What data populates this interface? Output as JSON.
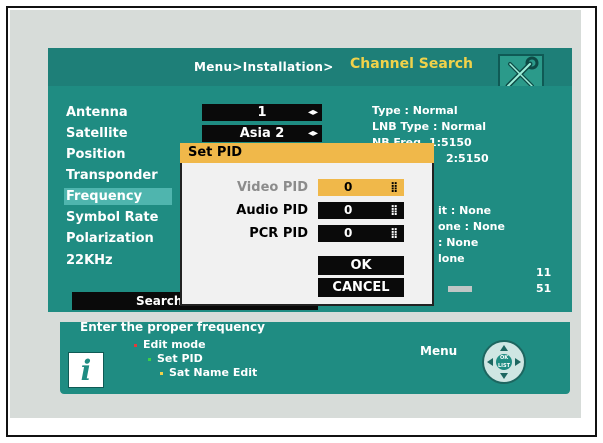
{
  "header": {
    "breadcrumb": "Menu>Installation>",
    "title": "Channel Search"
  },
  "settings": [
    {
      "label": "Antenna",
      "value": "1",
      "arrows": "◂▸"
    },
    {
      "label": "Satellite",
      "value": "Asia 2",
      "arrows": "◂▸"
    },
    {
      "label": "Position",
      "value": ""
    },
    {
      "label": "Transponder",
      "value": ""
    },
    {
      "label": "Frequency",
      "value": ""
    },
    {
      "label": "Symbol Rate",
      "value": ""
    },
    {
      "label": "Polarization",
      "value": ""
    },
    {
      "label": "22KHz",
      "value": ""
    }
  ],
  "info": {
    "type": "Type : Normal",
    "lnb_type": "LNB Type : Normal",
    "lnb_freq1": "NB Freq. 1:5150",
    "lnb_freq2": "2:5150",
    "partial1": "it : None",
    "partial2": "one : None",
    "partial3": ": None",
    "partial4": "lone",
    "level1": "11",
    "level2": "51"
  },
  "search_button": "Search",
  "dialog": {
    "title": "Set PID",
    "video_label": "Video PID",
    "video_value": "0",
    "audio_label": "Audio PID",
    "audio_value": "0",
    "pcr_label": "PCR  PID",
    "pcr_value": "0",
    "ok": "OK",
    "cancel": "CANCEL"
  },
  "help": {
    "text": "Enter the proper frequency",
    "items": [
      "Edit mode",
      "Set PID",
      "Sat Name Edit"
    ],
    "menu_label": "Menu",
    "pad_label": "OK LIST"
  },
  "colors": {
    "panel": "#1f8c82",
    "highlight": "#f0b84a",
    "title": "#f0d24a",
    "bullet1": "#e23b3b",
    "bullet2": "#3bd04a",
    "bullet3": "#f0d24a"
  }
}
